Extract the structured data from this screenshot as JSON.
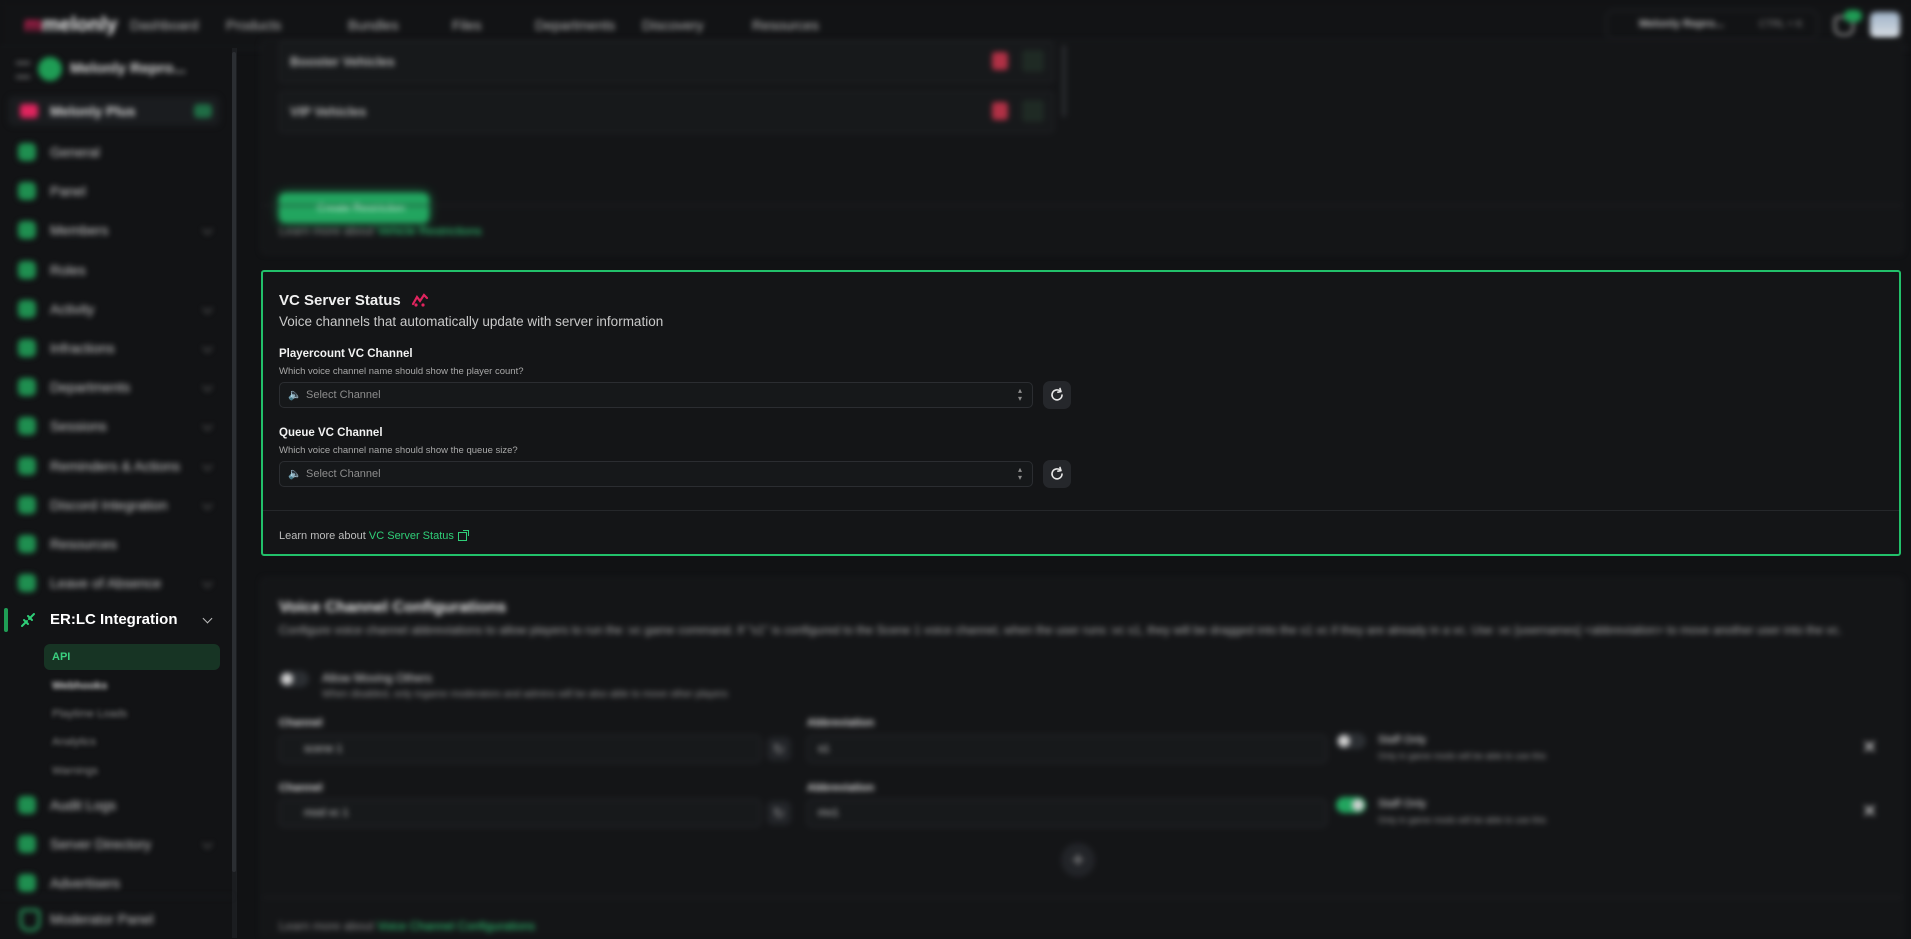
{
  "topnav": {
    "logo_prefix": "m",
    "logo_rest": "melonly",
    "items": [
      "Dashboard",
      "Products",
      "Bundles",
      "Files",
      "Departments",
      "Discovery",
      "Resources"
    ],
    "server_label": "Melonly Repro...",
    "shortcut": "CTRL + K"
  },
  "sidebar": {
    "server_name": "Melonly Repro...",
    "plus_label": "Melonly Plus",
    "items": [
      {
        "label": "General",
        "chev": false
      },
      {
        "label": "Panel",
        "chev": false
      },
      {
        "label": "Members",
        "chev": true
      },
      {
        "label": "Roles",
        "chev": false
      },
      {
        "label": "Activity",
        "chev": true
      },
      {
        "label": "Infractions",
        "chev": true
      },
      {
        "label": "Departments",
        "chev": true
      },
      {
        "label": "Sessions",
        "chev": true
      },
      {
        "label": "Reminders & Actions",
        "chev": true
      },
      {
        "label": "Discord Integration",
        "chev": true
      },
      {
        "label": "Resources",
        "chev": false
      },
      {
        "label": "Leave of Absence",
        "chev": true
      }
    ],
    "active_section": "ER:LC Integration",
    "active_sub": "API",
    "subitems": [
      "Webhooks",
      "Playtime Loads",
      "Analytics",
      "Warnings"
    ],
    "items_after": [
      {
        "label": "Audit Logs",
        "chev": false
      },
      {
        "label": "Server Directory",
        "chev": true
      },
      {
        "label": "Advertisers",
        "chev": false
      }
    ],
    "footer_label": "Moderator Panel"
  },
  "vehicle_card": {
    "rows": [
      "Booster Vehicles",
      "VIP Vehicles"
    ],
    "create_label": "Create Restriction",
    "learn_prefix": "Learn more about ",
    "learn_link": "Vehicle Restrictions"
  },
  "vc_status": {
    "title": "VC Server Status",
    "subtitle": "Voice channels that automatically update with server information",
    "playercount": {
      "label": "Playercount VC Channel",
      "help": "Which voice channel name should show the player count?",
      "placeholder": "Select Channel"
    },
    "queue": {
      "label": "Queue VC Channel",
      "help": "Which voice channel name should show the queue size?",
      "placeholder": "Select Channel"
    },
    "learn_prefix": "Learn more about ",
    "learn_link": "VC Server Status"
  },
  "voice_config": {
    "title": "Voice Channel Configurations",
    "desc": "Configure voice channel abbreviations to allow players to run the :vc game command. If \"s1\" is configured to the Scene 1 voice channel, when the user runs :vc s1, they will be dragged into the s1 vc if they are already in a vc. Use :vc [usernames] <abbreviation> to move another user into the vc.",
    "moving_label": "Allow Moving Others",
    "moving_help": "When disabled, only ingame moderators and admins will be also able to move other players",
    "channel_label": "Channel",
    "abbr_label": "Abbreviation",
    "rows": [
      {
        "channel": "scene 1",
        "abbr": "s1",
        "staff_label": "Staff Only",
        "staff_help": "Only in game mods will be able to use this",
        "on": false
      },
      {
        "channel": "mod vc 1",
        "abbr": "mv1",
        "staff_label": "Staff Only",
        "staff_help": "Only in game mods will be able to use this",
        "on": true
      }
    ],
    "learn_prefix": "Learn more about ",
    "learn_link": "Voice Channel Configurations"
  },
  "colors": {
    "accent": "#22c06a",
    "brand": "#e0245e",
    "bg": "#111214"
  }
}
